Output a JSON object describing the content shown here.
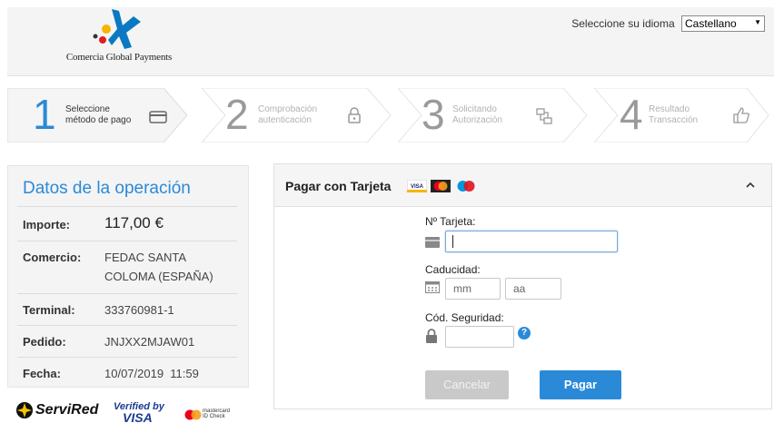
{
  "header": {
    "logo_text": "Comercia Global Payments",
    "language_label": "Seleccione su idioma",
    "language_value": "Castellano"
  },
  "steps": [
    {
      "number": "1",
      "line1": "Seleccione",
      "line2": "método de pago",
      "icon": "card-icon",
      "state": "active"
    },
    {
      "number": "2",
      "line1": "Comprobación",
      "line2": "autenticación",
      "icon": "lock-icon",
      "state": "inactive"
    },
    {
      "number": "3",
      "line1": "Solicitando",
      "line2": "Autorización",
      "icon": "transfer-icon",
      "state": "inactive"
    },
    {
      "number": "4",
      "line1": "Resultado",
      "line2": "Transacción",
      "icon": "thumbs-up-icon",
      "state": "inactive"
    }
  ],
  "operation": {
    "title": "Datos de la operación",
    "rows": [
      {
        "label": "Importe:",
        "value": "117,00 €"
      },
      {
        "label": "Comercio:",
        "value": "FEDAC SANTA COLOMA (ESPAÑA)"
      },
      {
        "label": "Terminal:",
        "value": "333760981-1"
      },
      {
        "label": "Pedido:",
        "value": "JNJXX2MJAW01"
      },
      {
        "label": "Fecha:",
        "value": "10/07/2019  11:59"
      }
    ]
  },
  "brands": {
    "servired": "ServiRed",
    "verified_top": "Verified by",
    "verified_bottom": "VISA",
    "mastercard_line1": "mastercard",
    "mastercard_line2": "ID Check"
  },
  "payment": {
    "title": "Pagar con Tarjeta",
    "card_logos": [
      "VISA",
      "MasterCard",
      "Maestro"
    ],
    "card_number_label": "Nº Tarjeta:",
    "card_number_value": "",
    "expiry_label": "Caducidad:",
    "month_placeholder": "mm",
    "year_placeholder": "aa",
    "cvv_label": "Cód. Seguridad:",
    "help_icon": "?",
    "cancel_label": "Cancelar",
    "pay_label": "Pagar"
  },
  "colors": {
    "accent": "#2a8ad8",
    "panel": "#f4f4f4",
    "cancel_disabled": "#c9c9c9"
  }
}
